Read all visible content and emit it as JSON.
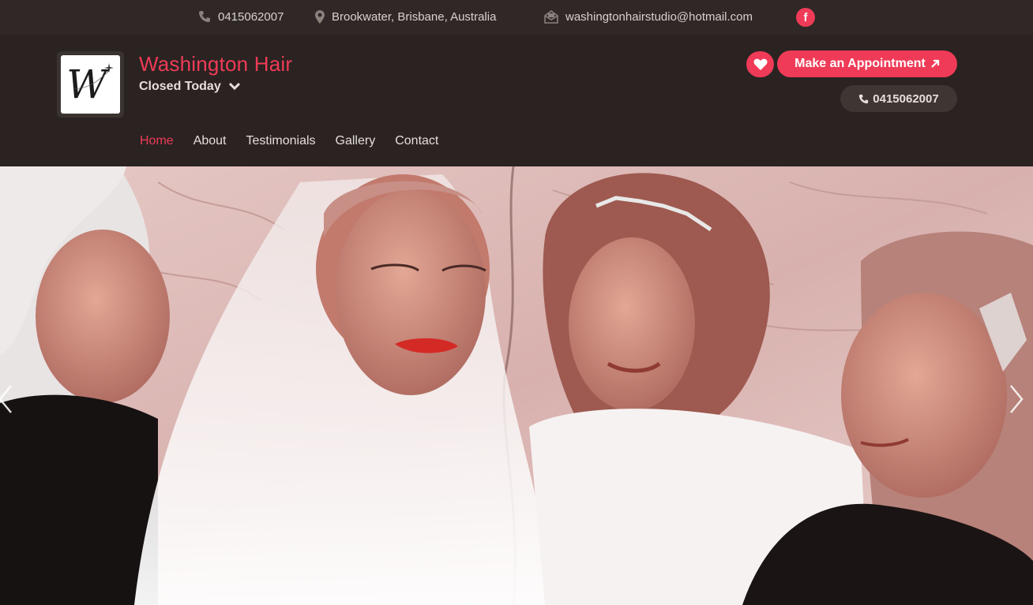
{
  "topbar": {
    "phone": "0415062007",
    "location": "Brookwater, Brisbane, Australia",
    "email": "washingtonhairstudio@hotmail.com",
    "facebook": "f"
  },
  "header": {
    "logo_letter": "W",
    "business_name": "Washington Hair",
    "hours_status": "Closed Today",
    "appointment_label": "Make an Appointment",
    "phone_label": "0415062007"
  },
  "nav": {
    "items": [
      "Home",
      "About",
      "Testimonials",
      "Gallery",
      "Contact"
    ],
    "active": "Home"
  },
  "colors": {
    "accent": "#ef3b57",
    "header_bg": "#2a2321",
    "topbar_bg": "#2f2826"
  },
  "icons": {
    "phone": "phone-icon",
    "location": "map-pin-icon",
    "email": "envelope-icon",
    "facebook": "facebook-icon",
    "heart": "heart-icon",
    "chevron": "chevron-down-icon",
    "external": "arrow-up-right-icon",
    "prev": "chevron-left-icon",
    "next": "chevron-right-icon"
  }
}
